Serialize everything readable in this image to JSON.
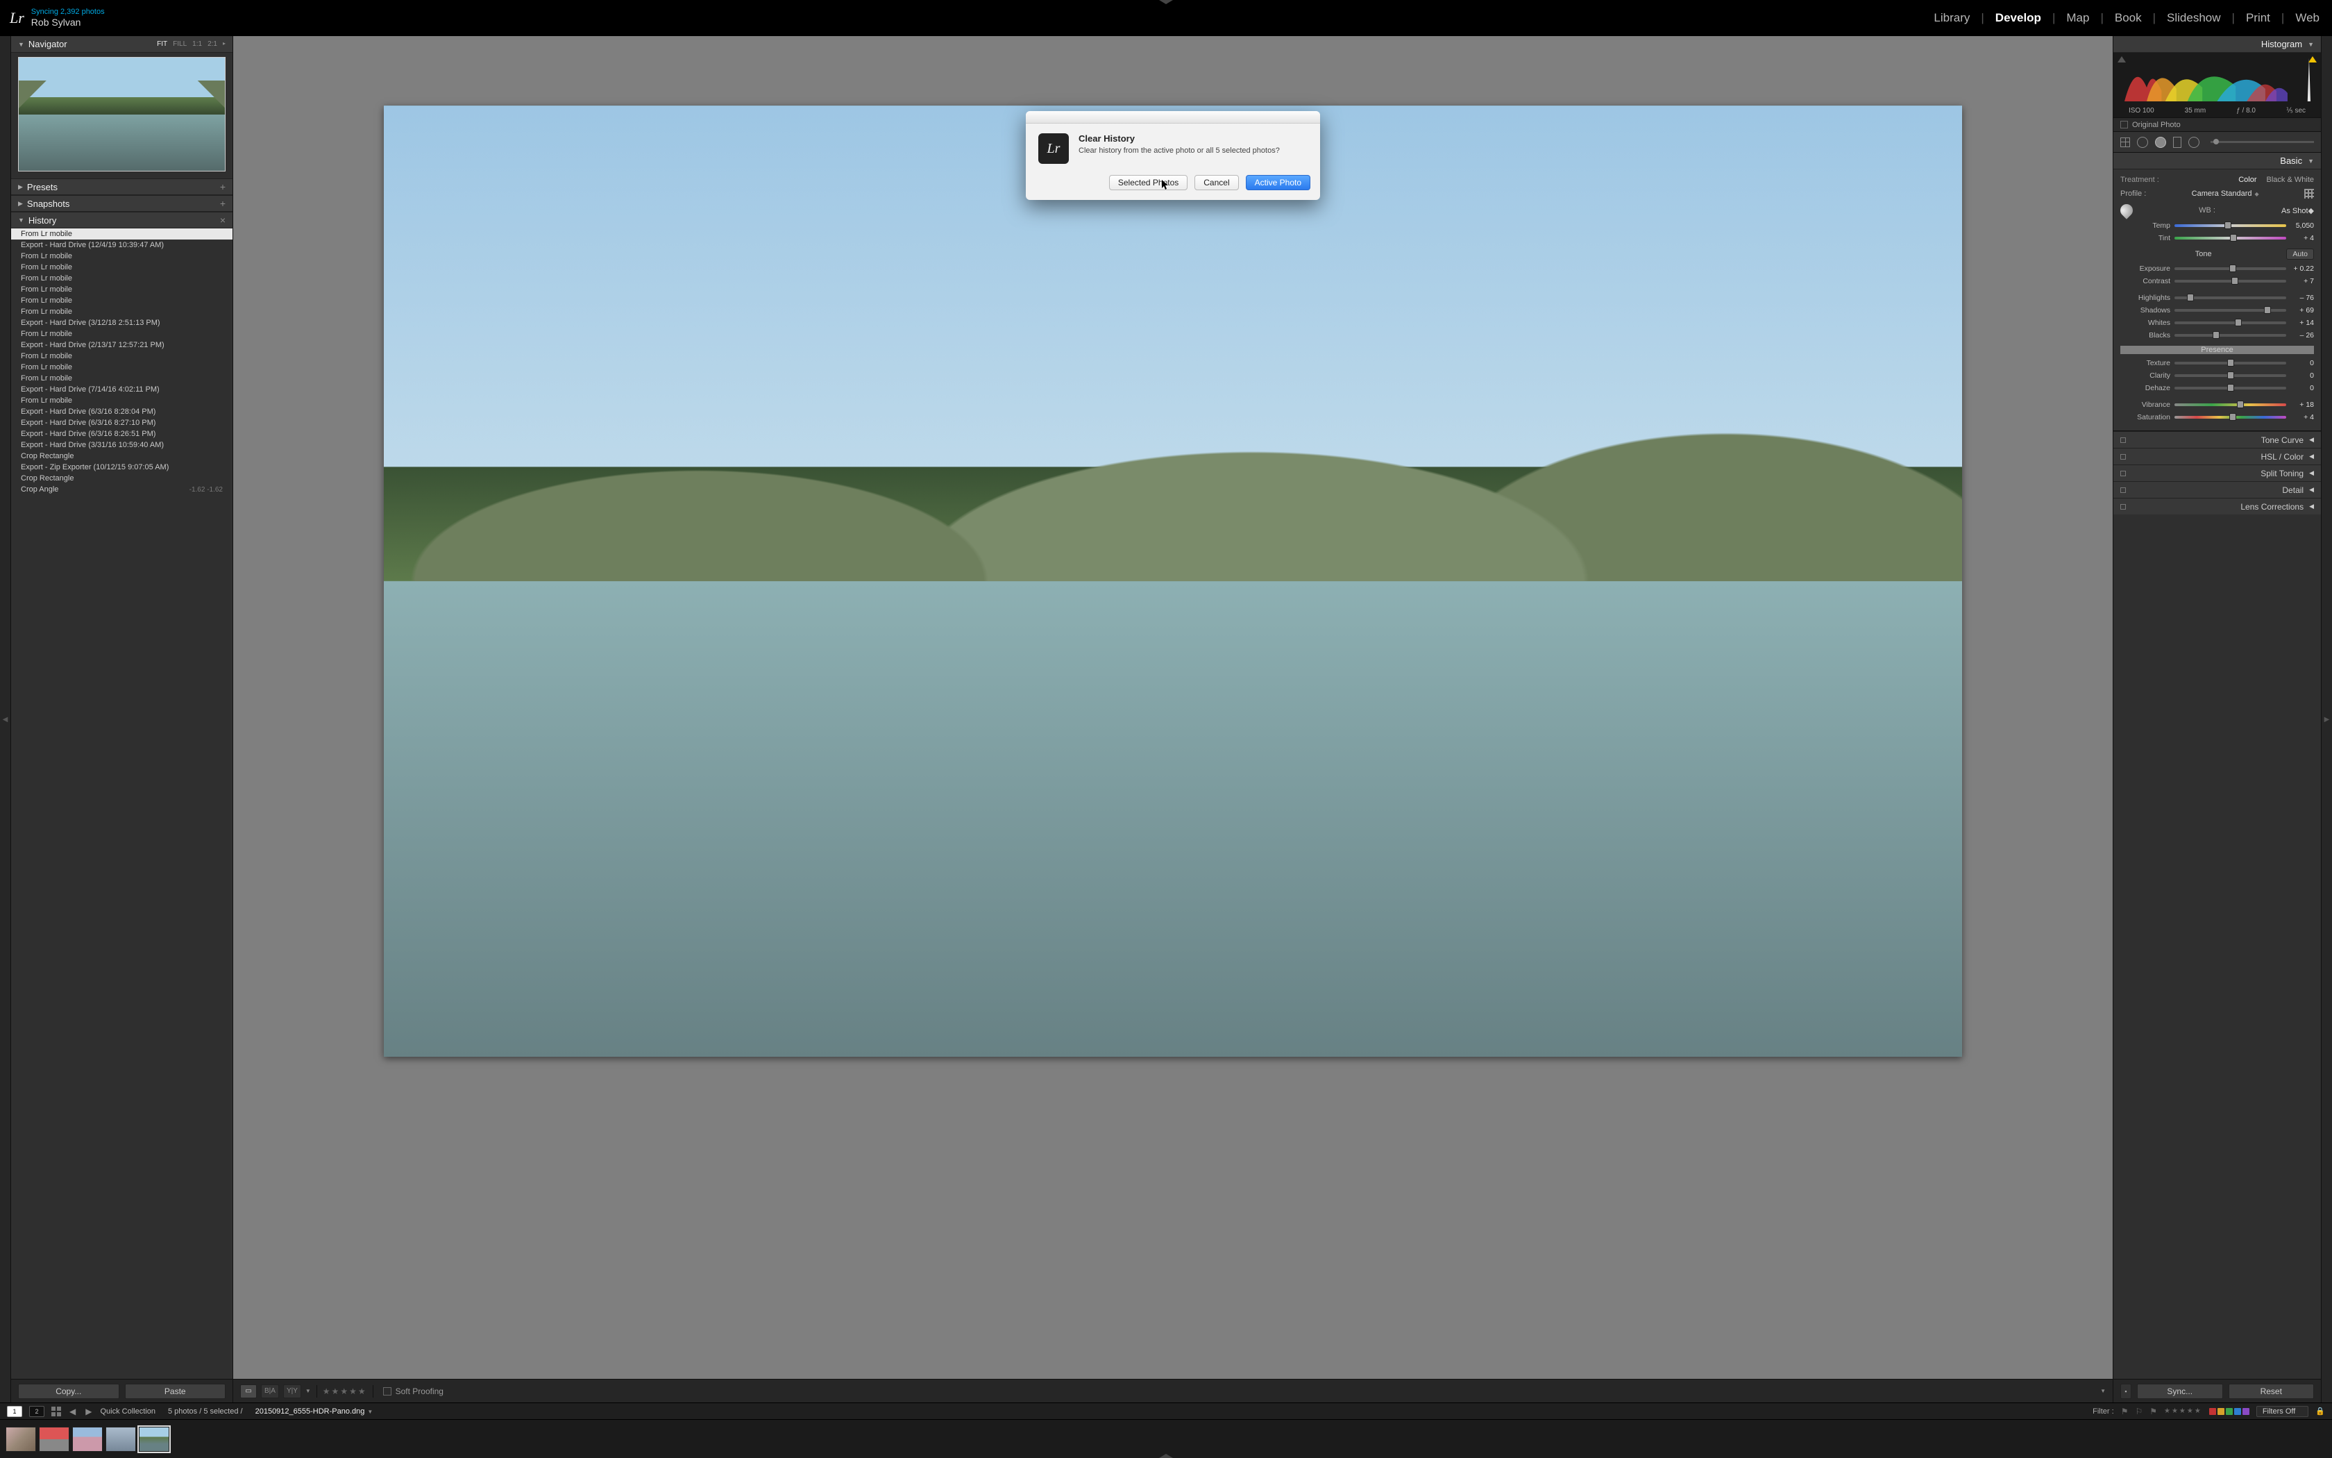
{
  "identity": {
    "logo_text": "Lr",
    "sync_status": "Syncing 2,392 photos",
    "user_name": "Rob Sylvan"
  },
  "modules": {
    "items": [
      "Library",
      "Develop",
      "Map",
      "Book",
      "Slideshow",
      "Print",
      "Web"
    ],
    "active": "Develop"
  },
  "navigator": {
    "title": "Navigator",
    "zoom_modes": [
      "FIT",
      "FILL",
      "1:1",
      "2:1"
    ],
    "zoom_active": "FIT"
  },
  "left_sections": {
    "presets": "Presets",
    "snapshots": "Snapshots",
    "history": "History"
  },
  "history": {
    "items": [
      "From Lr mobile",
      "Export - Hard Drive (12/4/19 10:39:47 AM)",
      "From Lr mobile",
      "From Lr mobile",
      "From Lr mobile",
      "From Lr mobile",
      "From Lr mobile",
      "From Lr mobile",
      "Export - Hard Drive (3/12/18 2:51:13 PM)",
      "From Lr mobile",
      "Export - Hard Drive (2/13/17 12:57:21 PM)",
      "From Lr mobile",
      "From Lr mobile",
      "From Lr mobile",
      "Export - Hard Drive (7/14/16 4:02:11 PM)",
      "From Lr mobile",
      "Export - Hard Drive (6/3/16 8:28:04 PM)",
      "Export - Hard Drive (6/3/16 8:27:10 PM)",
      "Export - Hard Drive (6/3/16 8:26:51 PM)",
      "Export - Hard Drive (3/31/16 10:59:40 AM)",
      "Crop Rectangle",
      "Export - Zip Exporter (10/12/15 9:07:05 AM)",
      "Crop Rectangle"
    ],
    "last_item": {
      "label": "Crop Angle",
      "value": "-1.62  -1.62"
    },
    "selected_index": 0
  },
  "left_footer": {
    "copy": "Copy...",
    "paste": "Paste"
  },
  "center_toolbar": {
    "soft_proofing_label": "Soft Proofing",
    "view_modes": [
      "loupe",
      "compare-ba",
      "compare-yy"
    ],
    "flag_label": "flag"
  },
  "right_panel": {
    "histogram_title": "Histogram",
    "histogram_meta": {
      "iso": "ISO 100",
      "focal": "35 mm",
      "aperture": "ƒ / 8.0",
      "shutter": "⅕ sec"
    },
    "original_photo_label": "Original Photo",
    "basic_title": "Basic",
    "treatment_label": "Treatment :",
    "treatment_color": "Color",
    "treatment_bw": "Black & White",
    "profile_label": "Profile :",
    "profile_value": "Camera Standard",
    "wb_label": "WB :",
    "wb_value": "As Shot",
    "tone_label": "Tone",
    "auto_label": "Auto",
    "presence_label": "Presence",
    "sliders": {
      "temp": {
        "label": "Temp",
        "value": "5,050",
        "pos": 48
      },
      "tint": {
        "label": "Tint",
        "value": "+ 4",
        "pos": 53
      },
      "exposure": {
        "label": "Exposure",
        "value": "+ 0.22",
        "pos": 52
      },
      "contrast": {
        "label": "Contrast",
        "value": "+ 7",
        "pos": 54
      },
      "highlights": {
        "label": "Highlights",
        "value": "– 76",
        "pos": 14
      },
      "shadows": {
        "label": "Shadows",
        "value": "+ 69",
        "pos": 83
      },
      "whites": {
        "label": "Whites",
        "value": "+ 14",
        "pos": 57
      },
      "blacks": {
        "label": "Blacks",
        "value": "– 26",
        "pos": 37
      },
      "texture": {
        "label": "Texture",
        "value": "0",
        "pos": 50
      },
      "clarity": {
        "label": "Clarity",
        "value": "0",
        "pos": 50
      },
      "dehaze": {
        "label": "Dehaze",
        "value": "0",
        "pos": 50
      },
      "vibrance": {
        "label": "Vibrance",
        "value": "+ 18",
        "pos": 59
      },
      "saturation": {
        "label": "Saturation",
        "value": "+ 4",
        "pos": 52
      }
    },
    "collapsed": [
      "Tone Curve",
      "HSL / Color",
      "Split Toning",
      "Detail",
      "Lens Corrections"
    ]
  },
  "right_footer": {
    "sync": "Sync...",
    "reset": "Reset"
  },
  "filmstrip": {
    "screen_buttons": [
      "1",
      "2"
    ],
    "screen_active": "1",
    "collection_label": "Quick Collection",
    "count_label": "5 photos / 5 selected /",
    "filename": "20150912_6555-HDR-Pano.dng",
    "filter_label": "Filter :",
    "filter_dropdown": "Filters Off",
    "color_chips": [
      "#c43434",
      "#d6a22c",
      "#3aa34a",
      "#2e7ed1",
      "#8a4ac4"
    ]
  },
  "dialog": {
    "title": "Clear History",
    "message": "Clear history from the active photo or all 5 selected photos?",
    "btn_selected": "Selected Photos",
    "btn_cancel": "Cancel",
    "btn_active": "Active Photo"
  }
}
